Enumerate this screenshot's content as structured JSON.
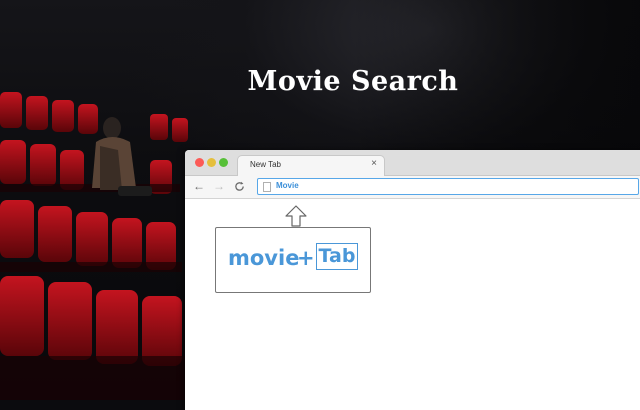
{
  "banner": {
    "title": "Movie Search"
  },
  "browser": {
    "tab_title": "New Tab",
    "close_glyph": "×",
    "nav": {
      "back": "←",
      "forward": "→",
      "reload": "C"
    },
    "omnibox_text": "Movie"
  },
  "callout": {
    "word": "movie",
    "plus": "+",
    "tab": "Tab"
  },
  "colors": {
    "accent": "#4a97d8",
    "seat_red": "#b3121c",
    "traffic_red": "#fc5b57",
    "traffic_yellow": "#e5bf3c",
    "traffic_green": "#57c038"
  },
  "icons": [
    "close-icon",
    "back-arrow-icon",
    "forward-arrow-icon",
    "reload-icon",
    "page-icon",
    "up-arrow-icon"
  ]
}
